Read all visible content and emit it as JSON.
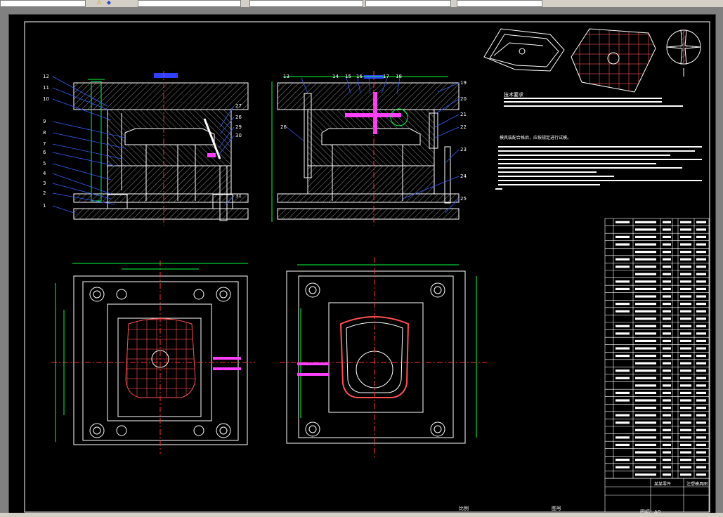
{
  "toolbar": {
    "fields": [
      "",
      "",
      "",
      "",
      ""
    ],
    "icons": [
      "warning-icon",
      "layers-icon"
    ]
  },
  "section_view_1": {
    "callouts": [
      "12",
      "11",
      "10",
      "9",
      "8",
      "7",
      "6",
      "5",
      "4",
      "3",
      "2",
      "1",
      "27",
      "26",
      "29",
      "30",
      "31"
    ]
  },
  "section_view_2": {
    "callouts": [
      "13",
      "14",
      "15",
      "16",
      "17",
      "18",
      "19",
      "20",
      "21",
      "22",
      "23",
      "24",
      "25",
      "26"
    ]
  },
  "tech_requirements": {
    "heading": "技术要求",
    "notes_heading": "模具装配合格后，应按规定进行试模。"
  },
  "bom": {
    "row_count": 35
  },
  "title_block": {
    "title": "某某零件",
    "drawing_no": "注塑模具图",
    "scale_label": "比例",
    "sheet_label": "图号",
    "format_label": "图幅：",
    "format_value": "A0"
  },
  "colors": {
    "outline": "#ffffff",
    "hatch": "#9a9a9a",
    "center": "#ff3030",
    "dimension": "#00ff40",
    "callout_leader": "#3060ff",
    "cooling": "#ff40ff",
    "runner": "#3040ff",
    "part": "#ffffff"
  }
}
